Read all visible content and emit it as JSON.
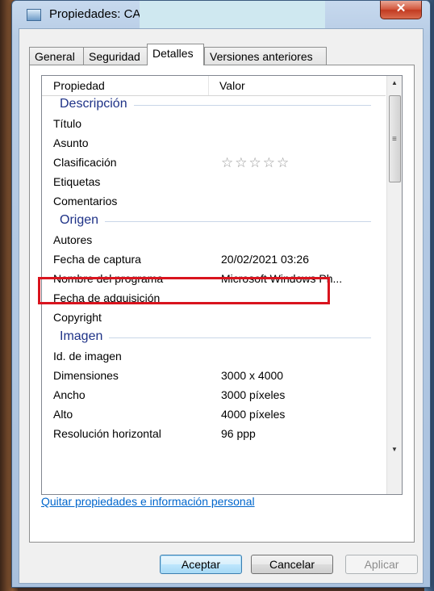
{
  "window": {
    "title": "Propiedades: CA"
  },
  "tabs": [
    "General",
    "Seguridad",
    "Detalles",
    "Versiones anteriores"
  ],
  "active_tab": "Detalles",
  "list": {
    "col_property": "Propiedad",
    "col_value": "Valor",
    "groups": {
      "descripcion": "Descripción",
      "origen": "Origen",
      "imagen": "Imagen"
    },
    "rows": [
      {
        "p": "Título",
        "v": ""
      },
      {
        "p": "Asunto",
        "v": ""
      },
      {
        "p": "Clasificación",
        "v": "☆☆☆☆☆"
      },
      {
        "p": "Etiquetas",
        "v": ""
      },
      {
        "p": "Comentarios",
        "v": ""
      },
      {
        "p": "Autores",
        "v": ""
      },
      {
        "p": "Fecha de captura",
        "v": "20/02/2021 03:26"
      },
      {
        "p": "Nombre del programa",
        "v": "Microsoft Windows Ph..."
      },
      {
        "p": "Fecha de adquisición",
        "v": ""
      },
      {
        "p": "Copyright",
        "v": ""
      },
      {
        "p": "Id. de imagen",
        "v": ""
      },
      {
        "p": "Dimensiones",
        "v": "3000 x 4000"
      },
      {
        "p": "Ancho",
        "v": "3000 píxeles"
      },
      {
        "p": "Alto",
        "v": "4000 píxeles"
      },
      {
        "p": "Resolución horizontal",
        "v": "96 ppp"
      }
    ]
  },
  "link": "Quitar propiedades e información personal",
  "buttons": {
    "ok": "Aceptar",
    "cancel": "Cancelar",
    "apply": "Aplicar"
  },
  "colors": {
    "highlight": "#d9141e",
    "link": "#0066cc",
    "group_text": "#1e3287"
  }
}
